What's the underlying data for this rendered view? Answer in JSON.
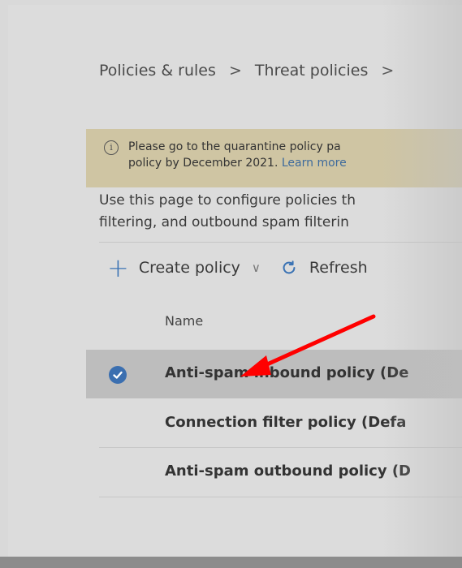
{
  "breadcrumb": {
    "items": [
      "Policies & rules",
      "Threat policies"
    ],
    "separator": ">"
  },
  "notice": {
    "icon": "info-icon",
    "line1": "Please go to the quarantine policy pa",
    "line2_prefix": "policy by December 2021. ",
    "link": "Learn more"
  },
  "description": {
    "line1": "Use this page to configure policies th",
    "line2": "filtering, and outbound spam filterin"
  },
  "toolbar": {
    "create_label": "Create policy",
    "refresh_label": "Refresh"
  },
  "table": {
    "column_name": "Name",
    "rows": [
      {
        "label": "Anti-spam inbound policy (De",
        "selected": true
      },
      {
        "label": "Connection filter policy (Defa",
        "selected": false
      },
      {
        "label": "Anti-spam outbound policy (D",
        "selected": false
      }
    ]
  },
  "colors": {
    "accent": "#3b73b4",
    "annotation_arrow": "#ff0000",
    "notice_bg": "#cfc5a3"
  }
}
